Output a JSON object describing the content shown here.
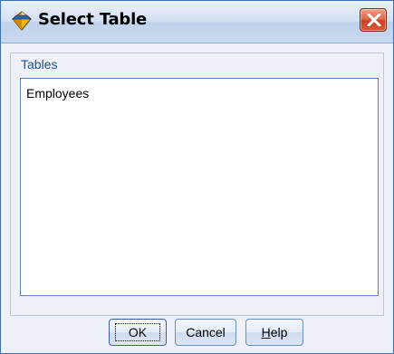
{
  "window": {
    "title": "Select Table",
    "app_icon": "diamond-icon",
    "close_icon": "close-icon"
  },
  "panel": {
    "label": "Tables"
  },
  "tables": [
    {
      "name": "Employees"
    }
  ],
  "buttons": {
    "ok_label": "OK",
    "cancel_label": "Cancel",
    "help_label_first": "H",
    "help_label_rest": "elp"
  },
  "colors": {
    "panel_label": "#1f4f93",
    "close_button": "#c94326",
    "listbox_border": "#5c84c4"
  }
}
